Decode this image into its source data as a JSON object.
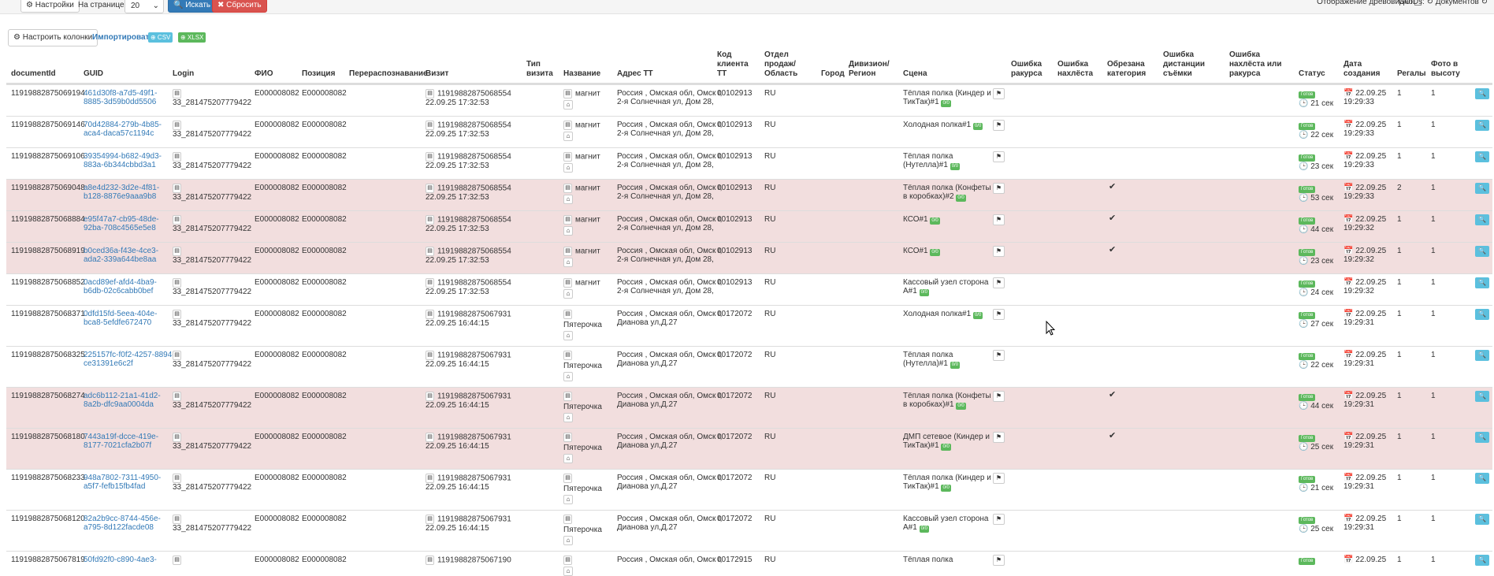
{
  "toolbar": {
    "settings_label": "⚙ Настройки",
    "perpage_label": "На странице:",
    "perpage_value": "20",
    "search_label": "🔍 Искать",
    "reset_label": "✖ Сбросить",
    "tree_label": "Отображение древовидно",
    "guids_label": "GUIDs: ↻ Документов ↻"
  },
  "bar2": {
    "columns_label": "⚙ Настроить колонки",
    "import_label": "Импортировать",
    "csv_label": "⊕ CSV",
    "xlsx_label": "⊕ XLSX"
  },
  "headers": {
    "documentId": "documentId",
    "guid": "GUID",
    "login": "Login",
    "fio": "ФИО",
    "position": "Позиция",
    "redistribution": "Перераспознавание",
    "visit": "Визит",
    "visit_type": "Тип визита",
    "name": "Название",
    "address": "Адрес ТТ",
    "client_code": "Код клиента ТТ",
    "sales_dept": "Отдел продаж/ Область",
    "city": "Город",
    "division": "Дивизион/ Регион",
    "scene": "Сцена",
    "angle_error": "Ошибка ракурса",
    "overlap_error": "Ошибка нахлёста",
    "cut_category": "Обрезана категория",
    "distance_error": "Ошибка дистанции съёмки",
    "overlap_angle_error": "Ошибка нахлёста или ракурса",
    "status": "Статус",
    "created": "Дата создания",
    "shelves": "Регалы",
    "photo_height": "Фото в высоту"
  },
  "rows": [
    {
      "doc_id": "11919882875069194",
      "guid_line1": "461d30f8-a7d5-49f1-",
      "guid_line2": "8885-3d59b0dd5506",
      "login": "33_281475207779422",
      "fio": "E000008082",
      "position": "E000008082",
      "visit_id": "11919882875068554",
      "visit_time": "22.09.25 17:32:53",
      "name": "магнит",
      "addr_line1": "Россия , Омская обл, Омск г,",
      "addr_line2": "2-я Солнечная ул, Дом 28,",
      "client_code": "00102913",
      "sales_dept": "RU",
      "scene_line1": "Тёплая полка (Киндер и",
      "scene_line2": "ТикТак)#1",
      "pct": "0/0",
      "cut": "",
      "status": "Готов",
      "status_time": "🕒 21 сек",
      "created_date": "📅 22.09.25",
      "created_time": "19:29:33",
      "shelves": "1",
      "photo": "1"
    },
    {
      "doc_id": "11919882875069146",
      "guid_line1": "70d42884-279b-4b85-",
      "guid_line2": "aca4-daca57c1194c",
      "login": "33_281475207779422",
      "fio": "E000008082",
      "position": "E000008082",
      "visit_id": "11919882875068554",
      "visit_time": "22.09.25 17:32:53",
      "name": "магнит",
      "addr_line1": "Россия , Омская обл, Омск г,",
      "addr_line2": "2-я Солнечная ул, Дом 28,",
      "client_code": "00102913",
      "sales_dept": "RU",
      "scene_line1": "Холодная полка#1",
      "scene_line2": "",
      "pct": "0/0",
      "cut": "",
      "status": "Готов",
      "status_time": "🕒 22 сек",
      "created_date": "📅 22.09.25",
      "created_time": "19:29:33",
      "shelves": "1",
      "photo": "1"
    },
    {
      "doc_id": "11919882875069106",
      "guid_line1": "39354994-b682-49d3-",
      "guid_line2": "883a-6b344cbbd3a1",
      "login": "33_281475207779422",
      "fio": "E000008082",
      "position": "E000008082",
      "visit_id": "11919882875068554",
      "visit_time": "22.09.25 17:32:53",
      "name": "магнит",
      "addr_line1": "Россия , Омская обл, Омск г,",
      "addr_line2": "2-я Солнечная ул, Дом 28,",
      "client_code": "00102913",
      "sales_dept": "RU",
      "scene_line1": "Тёплая полка",
      "scene_line2": "(Нутелла)#1",
      "pct": "0/0",
      "cut": "",
      "status": "Готов",
      "status_time": "🕒 23 сек",
      "created_date": "📅 22.09.25",
      "created_time": "19:29:33",
      "shelves": "1",
      "photo": "1"
    },
    {
      "doc_id": "11919882875069048",
      "guid_line1": "a8e4d232-3d2e-4f81-",
      "guid_line2": "b128-8876e9aaa9b8",
      "login": "33_281475207779422",
      "fio": "E000008082",
      "position": "E000008082",
      "visit_id": "11919882875068554",
      "visit_time": "22.09.25 17:32:53",
      "name": "магнит",
      "addr_line1": "Россия , Омская обл, Омск г,",
      "addr_line2": "2-я Солнечная ул, Дом 28,",
      "client_code": "00102913",
      "sales_dept": "RU",
      "scene_line1": "Тёплая полка (Конфеты",
      "scene_line2": "в коробках)#2",
      "pct": "0/0",
      "cut": "✔",
      "status": "Готов",
      "status_time": "🕒 53 сек",
      "created_date": "📅 22.09.25",
      "created_time": "19:29:33",
      "shelves": "2",
      "photo": "1"
    },
    {
      "doc_id": "11919882875068884",
      "guid_line1": "e95f47a7-cb95-48de-",
      "guid_line2": "92ba-708c4565e5e8",
      "login": "33_281475207779422",
      "fio": "E000008082",
      "position": "E000008082",
      "visit_id": "11919882875068554",
      "visit_time": "22.09.25 17:32:53",
      "name": "магнит",
      "addr_line1": "Россия , Омская обл, Омск г,",
      "addr_line2": "2-я Солнечная ул, Дом 28,",
      "client_code": "00102913",
      "sales_dept": "RU",
      "scene_line1": "КСО#1",
      "scene_line2": "",
      "pct": "0/0",
      "cut": "✔",
      "status": "Готов",
      "status_time": "🕒 44 сек",
      "created_date": "📅 22.09.25",
      "created_time": "19:29:32",
      "shelves": "1",
      "photo": "1"
    },
    {
      "doc_id": "11919882875068919",
      "guid_line1": "b0ced36a-f43e-4ce3-",
      "guid_line2": "ada2-339a644be8aa",
      "login": "33_281475207779422",
      "fio": "E000008082",
      "position": "E000008082",
      "visit_id": "11919882875068554",
      "visit_time": "22.09.25 17:32:53",
      "name": "магнит",
      "addr_line1": "Россия , Омская обл, Омск г,",
      "addr_line2": "2-я Солнечная ул, Дом 28,",
      "client_code": "00102913",
      "sales_dept": "RU",
      "scene_line1": "КСО#1",
      "scene_line2": "",
      "pct": "0/0",
      "cut": "✔",
      "status": "Готов",
      "status_time": "🕒 23 сек",
      "created_date": "📅 22.09.25",
      "created_time": "19:29:32",
      "shelves": "1",
      "photo": "1"
    },
    {
      "doc_id": "11919882875068852",
      "guid_line1": "0acd89ef-afd4-4ba9-",
      "guid_line2": "b6db-02c6cabb0bef",
      "login": "33_281475207779422",
      "fio": "E000008082",
      "position": "E000008082",
      "visit_id": "11919882875068554",
      "visit_time": "22.09.25 17:32:53",
      "name": "магнит",
      "addr_line1": "Россия , Омская обл, Омск г,",
      "addr_line2": "2-я Солнечная ул, Дом 28,",
      "client_code": "00102913",
      "sales_dept": "RU",
      "scene_line1": "Кассовый узел сторона",
      "scene_line2": "А#1",
      "pct": "0/0",
      "cut": "",
      "status": "Готов",
      "status_time": "🕒 24 сек",
      "created_date": "📅 22.09.25",
      "created_time": "19:29:32",
      "shelves": "1",
      "photo": "1"
    },
    {
      "doc_id": "11919882875068371",
      "guid_line1": "0dfd15fd-5eea-404e-",
      "guid_line2": "bca8-5efdfe672470",
      "login": "33_281475207779422",
      "fio": "E000008082",
      "position": "E000008082",
      "visit_id": "11919882875067931",
      "visit_time": "22.09.25 16:44:15",
      "name": "Пятерочка",
      "addr_line1": "Россия , Омская обл, Омск г,",
      "addr_line2": "Дианова ул,Д.27",
      "client_code": "00172072",
      "sales_dept": "RU",
      "scene_line1": "Холодная полка#1",
      "scene_line2": "",
      "pct": "0/0",
      "cut": "",
      "status": "Готов",
      "status_time": "🕒 27 сек",
      "created_date": "📅 22.09.25",
      "created_time": "19:29:31",
      "shelves": "1",
      "photo": "1"
    },
    {
      "doc_id": "11919882875068325",
      "guid_line1": "225157fc-f0f2-4257-8894-",
      "guid_line2": "ce31391e6c2f",
      "login": "33_281475207779422",
      "fio": "E000008082",
      "position": "E000008082",
      "visit_id": "11919882875067931",
      "visit_time": "22.09.25 16:44:15",
      "name": "Пятерочка",
      "addr_line1": "Россия , Омская обл, Омск г,",
      "addr_line2": "Дианова ул,Д.27",
      "client_code": "00172072",
      "sales_dept": "RU",
      "scene_line1": "Тёплая полка",
      "scene_line2": "(Нутелла)#1",
      "pct": "0/0",
      "cut": "",
      "status": "Готов",
      "status_time": "🕒 22 сек",
      "created_date": "📅 22.09.25",
      "created_time": "19:29:31",
      "shelves": "1",
      "photo": "1"
    },
    {
      "doc_id": "11919882875068274",
      "guid_line1": "adc6b112-21a1-41d2-",
      "guid_line2": "8a2b-dfc9aa0004da",
      "login": "33_281475207779422",
      "fio": "E000008082",
      "position": "E000008082",
      "visit_id": "11919882875067931",
      "visit_time": "22.09.25 16:44:15",
      "name": "Пятерочка",
      "addr_line1": "Россия , Омская обл, Омск г,",
      "addr_line2": "Дианова ул,Д.27",
      "client_code": "00172072",
      "sales_dept": "RU",
      "scene_line1": "Тёплая полка (Конфеты",
      "scene_line2": "в коробках)#1",
      "pct": "0/0",
      "cut": "✔",
      "status": "Готов",
      "status_time": "🕒 44 сек",
      "created_date": "📅 22.09.25",
      "created_time": "19:29:31",
      "shelves": "1",
      "photo": "1"
    },
    {
      "doc_id": "11919882875068180",
      "guid_line1": "7443a19f-dcce-419e-",
      "guid_line2": "8177-7021cfa2b07f",
      "login": "33_281475207779422",
      "fio": "E000008082",
      "position": "E000008082",
      "visit_id": "11919882875067931",
      "visit_time": "22.09.25 16:44:15",
      "name": "Пятерочка",
      "addr_line1": "Россия , Омская обл, Омск г,",
      "addr_line2": "Дианова ул,Д.27",
      "client_code": "00172072",
      "sales_dept": "RU",
      "scene_line1": "ДМП сетевое (Киндер и",
      "scene_line2": "ТикТак)#1",
      "pct": "0/0",
      "cut": "✔",
      "status": "Готов",
      "status_time": "🕒 25 сек",
      "created_date": "📅 22.09.25",
      "created_time": "19:29:31",
      "shelves": "1",
      "photo": "1"
    },
    {
      "doc_id": "11919882875068233",
      "guid_line1": "948a7802-7311-4950-",
      "guid_line2": "a5f7-fefb15fb4fad",
      "login": "33_281475207779422",
      "fio": "E000008082",
      "position": "E000008082",
      "visit_id": "11919882875067931",
      "visit_time": "22.09.25 16:44:15",
      "name": "Пятерочка",
      "addr_line1": "Россия , Омская обл, Омск г,",
      "addr_line2": "Дианова ул,Д.27",
      "client_code": "00172072",
      "sales_dept": "RU",
      "scene_line1": "Тёплая полка (Киндер и",
      "scene_line2": "ТикТак)#1",
      "pct": "0/0",
      "cut": "",
      "status": "Готов",
      "status_time": "🕒 21 сек",
      "created_date": "📅 22.09.25",
      "created_time": "19:29:31",
      "shelves": "1",
      "photo": "1"
    },
    {
      "doc_id": "11919882875068120",
      "guid_line1": "82a2b9cc-8744-456e-",
      "guid_line2": "a795-8d122facde08",
      "login": "33_281475207779422",
      "fio": "E000008082",
      "position": "E000008082",
      "visit_id": "11919882875067931",
      "visit_time": "22.09.25 16:44:15",
      "name": "Пятерочка",
      "addr_line1": "Россия , Омская обл, Омск г,",
      "addr_line2": "Дианова ул,Д.27",
      "client_code": "00172072",
      "sales_dept": "RU",
      "scene_line1": "Кассовый узел сторона",
      "scene_line2": "А#1",
      "pct": "0/0",
      "cut": "",
      "status": "Готов",
      "status_time": "🕒 25 сек",
      "created_date": "📅 22.09.25",
      "created_time": "19:29:31",
      "shelves": "1",
      "photo": "1"
    },
    {
      "doc_id": "11919882875067819",
      "guid_line1": "50fd92f0-c890-4ae3-",
      "guid_line2": "",
      "login": "",
      "fio": "E000008082",
      "position": "E000008082",
      "visit_id": "11919882875067190",
      "visit_time": "",
      "name": "",
      "addr_line1": "Россия , Омская обл, Омск г,",
      "addr_line2": "",
      "client_code": "00172915",
      "sales_dept": "RU",
      "scene_line1": "Тёплая полка",
      "scene_line2": "",
      "pct": "",
      "cut": "",
      "status": "Готов",
      "status_time": "",
      "created_date": "📅 22.09.25",
      "created_time": "",
      "shelves": "1",
      "photo": "1"
    }
  ]
}
